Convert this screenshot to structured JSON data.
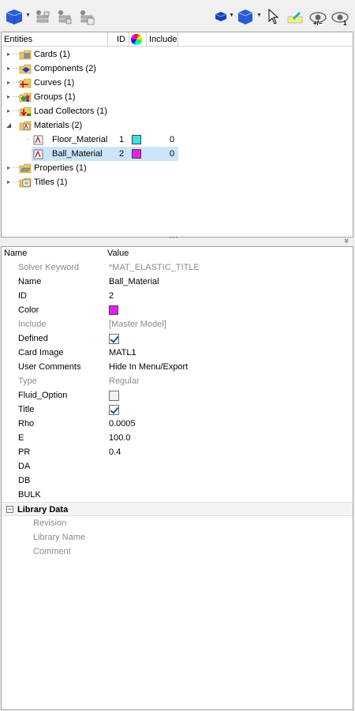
{
  "toolbar": {
    "left_icons": [
      "cube-icon",
      "tree-config-icon",
      "tree-config-2-icon",
      "tree-config-3-icon"
    ],
    "right_icons": [
      "small-cube-icon",
      "cube-view-icon",
      "cursor-icon",
      "highlight-icon",
      "eye-plusminus-icon",
      "eye-one-icon"
    ],
    "eye_plusminus_label": "+/−",
    "eye_one_label": "1"
  },
  "tree": {
    "headers": {
      "entities": "Entities",
      "id": "ID",
      "include": "Include"
    },
    "items": [
      {
        "label": "Cards (1)",
        "icon": "cards-folder-icon"
      },
      {
        "label": "Components (2)",
        "icon": "components-folder-icon"
      },
      {
        "label": "Curves (1)",
        "icon": "curves-folder-icon"
      },
      {
        "label": "Groups (1)",
        "icon": "groups-folder-icon"
      },
      {
        "label": "Load Collectors (1)",
        "icon": "load-collectors-folder-icon"
      },
      {
        "label": "Materials (2)",
        "icon": "materials-folder-icon"
      },
      {
        "label": "Floor_Material",
        "id": "1",
        "color": "#33e5e5",
        "include": "0"
      },
      {
        "label": "Ball_Material",
        "id": "2",
        "color": "#e61ee6",
        "include": "0"
      },
      {
        "label": "Properties (1)",
        "icon": "properties-folder-icon"
      },
      {
        "label": "Titles (1)",
        "icon": "titles-folder-icon"
      }
    ]
  },
  "splitter": {
    "dots": "• • •",
    "collapse": "»"
  },
  "properties": {
    "headers": {
      "name": "Name",
      "value": "Value"
    },
    "rows": [
      {
        "name": "Solver Keyword",
        "value": "*MAT_ELASTIC_TITLE"
      },
      {
        "name": "Name",
        "value": "Ball_Material"
      },
      {
        "name": "ID",
        "value": "2"
      },
      {
        "name": "Color",
        "value": "",
        "color": "#e61ee6"
      },
      {
        "name": "Include",
        "value": "[Master Model]"
      },
      {
        "name": "Defined",
        "value": "",
        "checked": true
      },
      {
        "name": "Card Image",
        "value": "MATL1"
      },
      {
        "name": "User Comments",
        "value": "Hide In Menu/Export"
      },
      {
        "name": "Type",
        "value": "Regular"
      },
      {
        "name": "Fluid_Option",
        "value": "",
        "checked": false
      },
      {
        "name": "Title",
        "value": "",
        "checked": true
      },
      {
        "name": "Rho",
        "value": "0.0005"
      },
      {
        "name": "E",
        "value": "100.0"
      },
      {
        "name": "PR",
        "value": "0.4"
      },
      {
        "name": "DA",
        "value": ""
      },
      {
        "name": "DB",
        "value": ""
      },
      {
        "name": "BULK",
        "value": ""
      }
    ],
    "library_section": "Library Data",
    "library_rows": [
      {
        "name": "Revision"
      },
      {
        "name": "Library Name"
      },
      {
        "name": "Comment"
      }
    ]
  }
}
